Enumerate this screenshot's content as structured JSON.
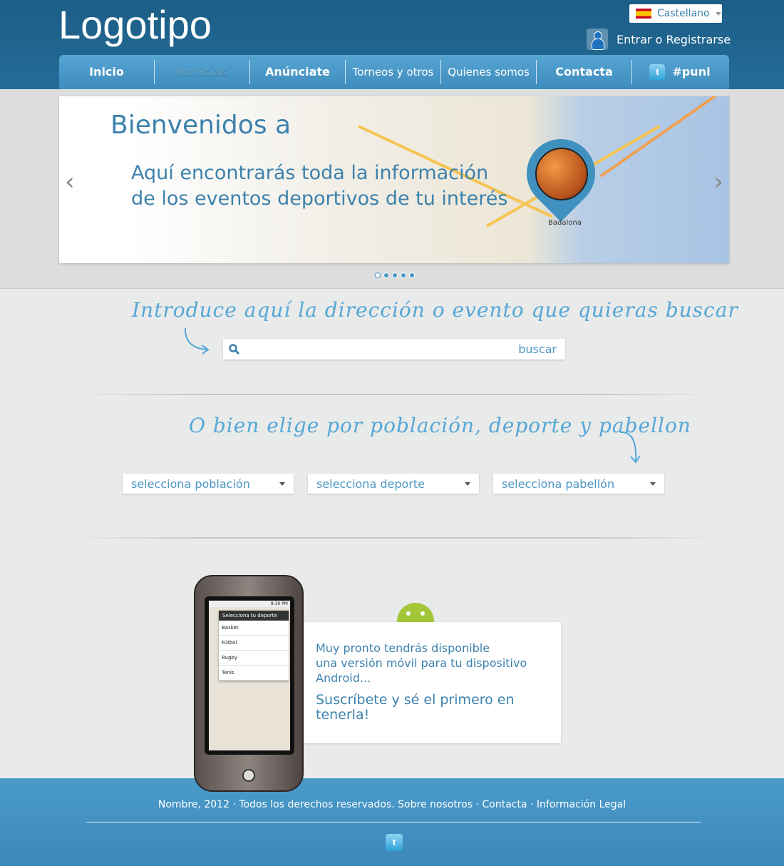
{
  "header": {
    "logo": "Logotipo",
    "language": "Castellano",
    "login": "Entrar o Registrarse"
  },
  "nav": {
    "items": [
      "Inicio",
      "Noticias",
      "Anúnciate",
      "Torneos y otros",
      "Quienes somos",
      "Contacta",
      "#puni"
    ],
    "active": "Noticias"
  },
  "banner": {
    "title": "Bienvenidos a",
    "subtitle_line1": "Aquí encontrarás toda la información",
    "subtitle_line2": "de los eventos deportivos de tu interés",
    "map_label": "Badalona",
    "slide_count": 5,
    "active_slide": 1
  },
  "search": {
    "heading": "Introduce aquí la dirección o evento que quieras buscar",
    "placeholder": "",
    "button": "buscar"
  },
  "filters": {
    "heading": "O bien elige por población, deporte y pabellon",
    "selects": [
      "selecciona población",
      "selecciona deporte",
      "selecciona pabellón"
    ]
  },
  "mobile": {
    "phone_time": "8:30 PM",
    "dialog_title": "Selecciona tu deporte",
    "sports": [
      "Basket",
      "Fútbol",
      "Rugby",
      "Tenis"
    ],
    "text_line1": "Muy pronto tendrás disponible",
    "text_line2": "una versión móvil para tu dispositivo",
    "text_line3": "Android...",
    "cta": "Suscríbete y sé el primero en tenerla!"
  },
  "footer": {
    "copyright": "Nombre, 2012 · Todos los derechos reservados.",
    "links": [
      "Sobre nosotros",
      "Contacta",
      "Información Legal"
    ]
  },
  "colors": {
    "header": "#1c5e86",
    "nav": "#4b9bc9",
    "accent": "#3d82ad",
    "android": "#a4c639"
  }
}
